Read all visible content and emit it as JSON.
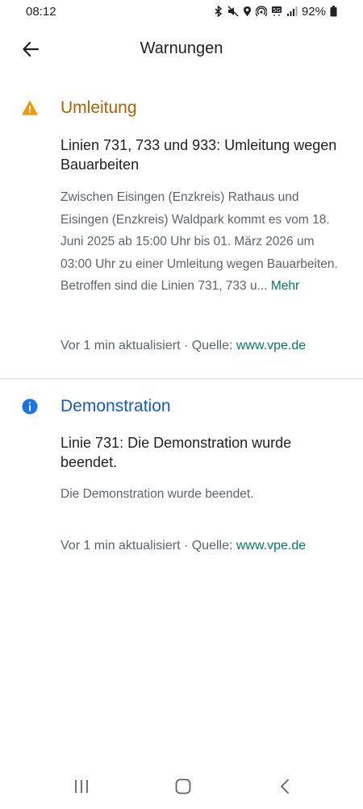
{
  "status_bar": {
    "time": "08:12",
    "battery": "92%"
  },
  "header": {
    "title": "Warnungen",
    "back_icon": "arrow-left-icon"
  },
  "alerts": [
    {
      "type": "Umleitung",
      "icon": "warning-icon",
      "color": "#b06000",
      "headline": "Linien 731, 733 und 933: Umleitung wegen Bauarbeiten",
      "body": "Zwischen Eisingen (Enzkreis) Rathaus und Eisingen (Enzkreis) Waldpark kommt es vom 18. Juni 2025 ab 15:00 Uhr bis 01. März 2026 um 03:00 Uhr zu einer Umleitung wegen Bauarbeiten. Betroffen sind die Linien 731, 733 u...",
      "more": "Mehr",
      "updated": "Vor 1 min aktualisiert · Quelle: ",
      "source": "www.vpe.de"
    },
    {
      "type": "Demonstration",
      "icon": "info-icon",
      "color": "#1558d6",
      "headline": "Linie 731: Die Demonstration wurde beendet.",
      "body": "Die Demonstration wurde beendet.",
      "updated": "Vor 1 min aktualisiert · Quelle: ",
      "source": "www.vpe.de"
    }
  ],
  "colors": {
    "link": "#00796b",
    "warning_icon": "#f29900",
    "info_icon": "#1a73e8"
  },
  "nav_bar": {
    "recents_icon": "recents-icon",
    "home_icon": "home-icon",
    "back_icon": "nav-back-icon"
  }
}
